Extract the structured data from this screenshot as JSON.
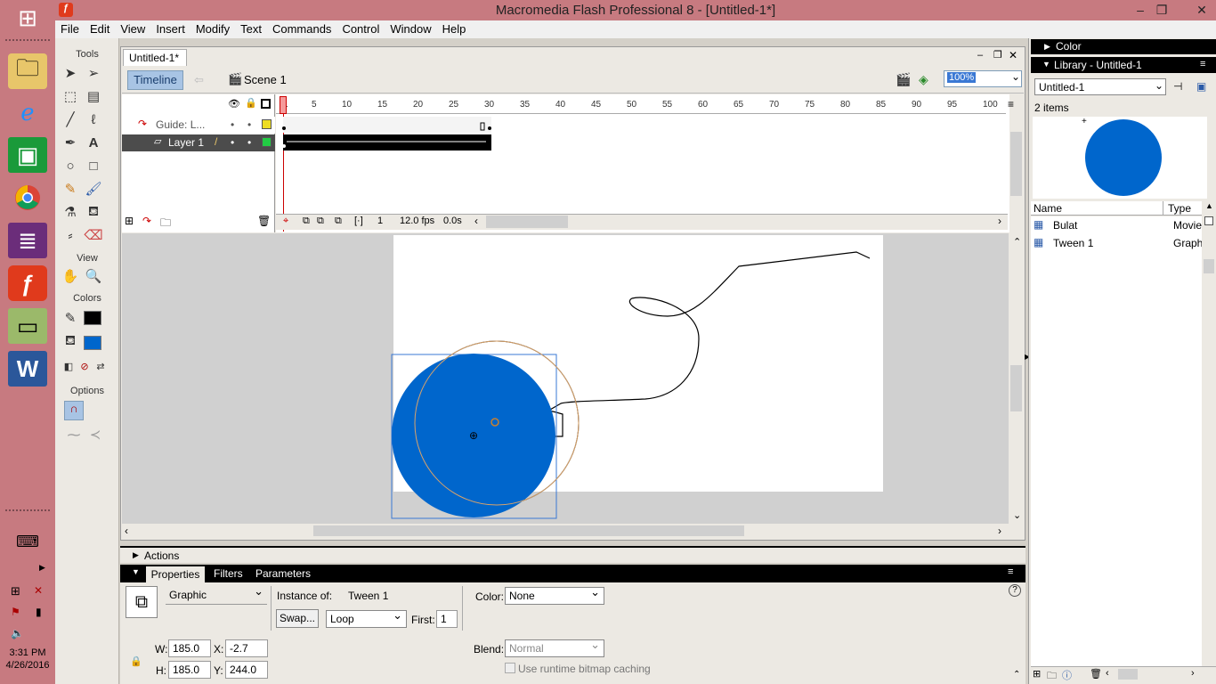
{
  "window": {
    "title": "Macromedia Flash Professional 8 - [Untitled-1*]",
    "minimize_icon": "minimize-icon",
    "maximize_icon": "restore-icon",
    "close_icon": "close-icon"
  },
  "menu": [
    "File",
    "Edit",
    "View",
    "Insert",
    "Modify",
    "Text",
    "Commands",
    "Control",
    "Window",
    "Help"
  ],
  "taskbar": {
    "time": "3:31 PM",
    "date": "4/26/2016"
  },
  "tools": {
    "title": "Tools",
    "view_label": "View",
    "colors_label": "Colors",
    "options_label": "Options",
    "stroke_color": "#000000",
    "fill_color": "#0066cc"
  },
  "document": {
    "tab": "Untitled-1*",
    "timeline_button": "Timeline",
    "scene": "Scene 1",
    "zoom": "100%"
  },
  "timeline": {
    "ruler": [
      "1",
      "5",
      "10",
      "15",
      "20",
      "25",
      "30",
      "35",
      "40",
      "45",
      "50",
      "55",
      "60",
      "65",
      "70",
      "75",
      "80",
      "85",
      "90",
      "95",
      "100"
    ],
    "layers": [
      {
        "name": "Guide: L..."
      },
      {
        "name": "Layer 1"
      }
    ],
    "current_frame": "1",
    "fps": "12.0 fps",
    "elapsed": "0.0s"
  },
  "stage": {
    "background": "#ffffff",
    "circle_color": "#0066cc"
  },
  "actions": {
    "label": "Actions"
  },
  "properties": {
    "tabs": [
      "Properties",
      "Filters",
      "Parameters"
    ],
    "symbol_type": "Graphic",
    "instance_of_label": "Instance of:",
    "instance_of": "Tween 1",
    "swap_button": "Swap...",
    "loop": "Loop",
    "first_label": "First:",
    "first": "1",
    "color_label": "Color:",
    "color": "None",
    "w_label": "W:",
    "w": "185.0",
    "h_label": "H:",
    "h": "185.0",
    "x_label": "X:",
    "x": "-2.7",
    "y_label": "Y:",
    "y": "244.0",
    "blend_label": "Blend:",
    "blend": "Normal",
    "cache_label": "Use runtime bitmap caching"
  },
  "panels": {
    "color_title": "Color",
    "library_title": "Library - Untitled-1",
    "library_doc": "Untitled-1",
    "item_count": "2 items",
    "columns": {
      "name": "Name",
      "type": "Type"
    },
    "items": [
      {
        "name": "Bulat",
        "type": "Movie"
      },
      {
        "name": "Tween 1",
        "type": "Graph"
      }
    ]
  }
}
